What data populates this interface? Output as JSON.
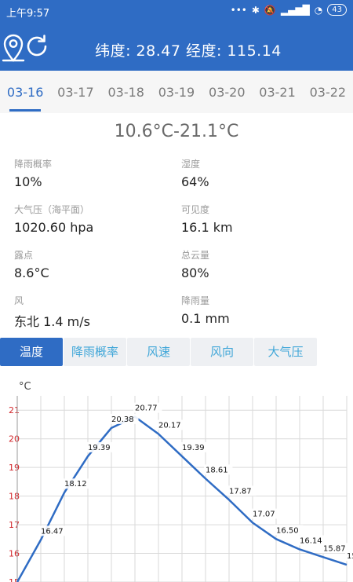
{
  "status_bar": {
    "time": "上午9:57",
    "signal_text": "•••",
    "battery": "43"
  },
  "header": {
    "title": "纬度: 28.47 经度: 115.14"
  },
  "date_tabs": [
    "03-16",
    "03-17",
    "03-18",
    "03-19",
    "03-20",
    "03-21",
    "03-22"
  ],
  "active_date_index": 0,
  "temperature_range": "10.6°C-21.1°C",
  "metrics": [
    {
      "label": "降雨概率",
      "value": "10%"
    },
    {
      "label": "湿度",
      "value": "64%"
    },
    {
      "label": "大气压（海平面）",
      "value": "1020.60 hpa"
    },
    {
      "label": "可见度",
      "value": "16.1 km"
    },
    {
      "label": "露点",
      "value": "8.6°C"
    },
    {
      "label": "总云量",
      "value": "80%"
    },
    {
      "label": "风",
      "value": "东北 1.4 m/s"
    },
    {
      "label": "降雨量",
      "value": "0.1 mm"
    }
  ],
  "chart_tabs": [
    "温度",
    "降雨概率",
    "风速",
    "风向",
    "大气压"
  ],
  "active_chart_tab": 0,
  "colors": {
    "primary": "#2f6cc4",
    "tab_text": "#3fa6d8",
    "axis_label": "#d2262b",
    "line": "#2f6cc4"
  },
  "chart_data": {
    "type": "line",
    "ylabel": "°C",
    "y_ticks": [
      "15",
      "16",
      "17",
      "18",
      "19",
      "20",
      "21"
    ],
    "ylim": [
      15,
      21.5
    ],
    "x": [
      0,
      1,
      2,
      3,
      4,
      5,
      6,
      7,
      8,
      9,
      10,
      11,
      12,
      13
    ],
    "values": [
      15.0,
      16.47,
      18.12,
      19.39,
      20.38,
      20.77,
      20.17,
      19.39,
      18.61,
      17.87,
      17.07,
      16.5,
      16.14,
      15.87,
      15.6
    ],
    "labels": [
      "",
      "16.47",
      "18.12",
      "19.39",
      "20.38",
      "20.77",
      "20.17",
      "19.39",
      "18.61",
      "17.87",
      "17.07",
      "16.50",
      "16.14",
      "15.87",
      "15"
    ],
    "grid": true
  }
}
